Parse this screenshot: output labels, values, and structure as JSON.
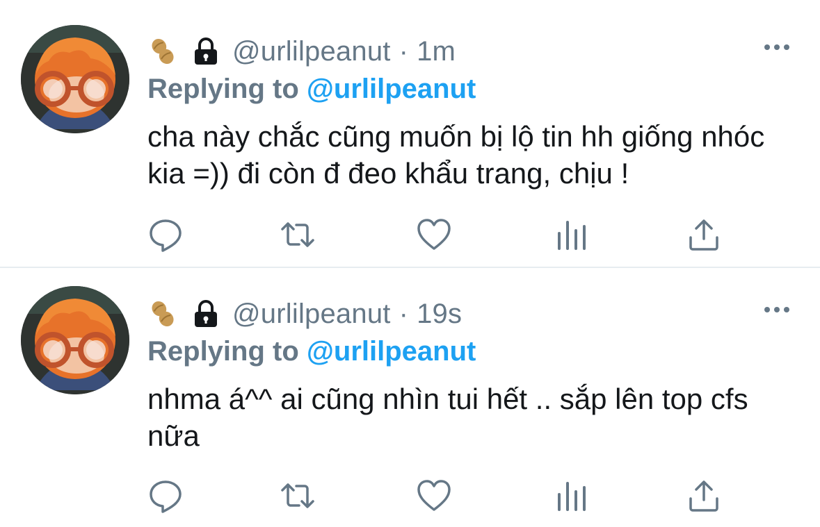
{
  "tweets": [
    {
      "handle": "@urlilpeanut",
      "separator": "·",
      "time": "1m",
      "replying_prefix": "Replying to",
      "replying_to": "@urlilpeanut",
      "text": "cha này chắc cũng muốn bị lộ tin hh giống nhóc kia =)) đi còn đ đeo khẩu trang, chịu !"
    },
    {
      "handle": "@urlilpeanut",
      "separator": "·",
      "time": "19s",
      "replying_prefix": "Replying to",
      "replying_to": "@urlilpeanut",
      "text": "nhma á^^ ai cũng nhìn tui hết .. sắp lên top cfs nữa"
    }
  ],
  "icons": {
    "name_emoji": "peanut-icon",
    "protected": "lock-icon",
    "more": "more-options-icon",
    "actions": [
      "reply-icon",
      "retweet-icon",
      "like-icon",
      "analytics-icon",
      "share-icon"
    ]
  },
  "colors": {
    "secondary_text": "#657786",
    "link": "#1da1f2",
    "primary_text": "#14171a",
    "divider": "#e6ecf0"
  }
}
